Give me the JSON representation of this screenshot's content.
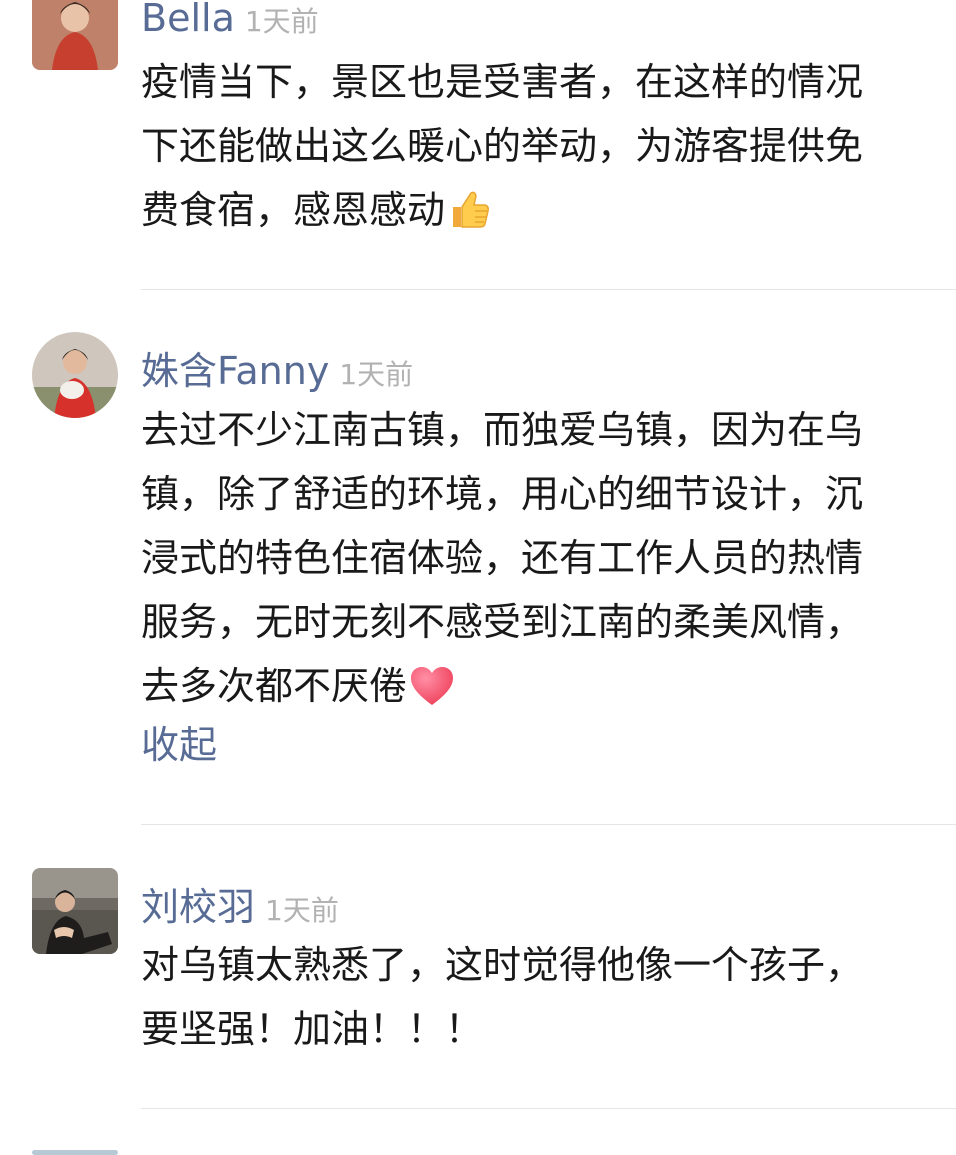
{
  "comments": [
    {
      "name": "Bella",
      "time": "1天前",
      "lines": [
        "疫情当下，景区也是受害者，在这样的情况",
        "下还能做出这么暖心的举动，为游客提供免",
        "费食宿，感恩感动"
      ],
      "emoji": "thumbs-up-icon"
    },
    {
      "name": "姝含Fanny",
      "time": "1天前",
      "lines": [
        "去过不少江南古镇，而独爱乌镇，因为在乌",
        "镇，除了舒适的环境，用心的细节设计，沉",
        "浸式的特色住宿体验，还有工作人员的热情",
        "服务，无时无刻不感受到江南的柔美风情，",
        "去多次都不厌倦"
      ],
      "emoji": "heart-icon",
      "collapse_label": "收起"
    },
    {
      "name": "刘校羽",
      "time": "1天前",
      "lines": [
        "对乌镇太熟悉了，这时觉得他像一个孩子，",
        "要坚强！加油！！！"
      ]
    }
  ],
  "colors": {
    "name": "#576b95",
    "time": "#b2b2b2",
    "text": "#191919",
    "divider": "#e5e5e5"
  }
}
